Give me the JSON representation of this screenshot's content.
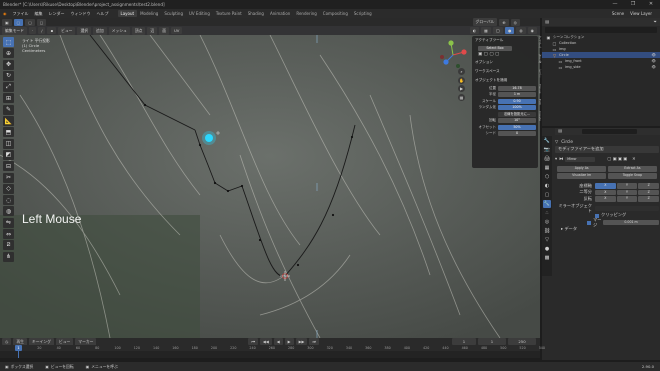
{
  "window": {
    "title": "Blender* [C:\\Users\\Rikuse\\Desktop\\Blender\\project_assignments\\test2.blend]",
    "controls": [
      "—",
      "❐",
      "✕"
    ]
  },
  "menu": {
    "app_icon": "blender-logo-icon",
    "items": [
      "ファイル",
      "編集",
      "レンダー",
      "ウィンドウ",
      "ヘルプ"
    ],
    "workspaces": [
      "Layout",
      "Modeling",
      "Sculpting",
      "UV Editing",
      "Texture Paint",
      "Shading",
      "Animation",
      "Rendering",
      "Compositing",
      "Scripting"
    ],
    "active_workspace": "Layout",
    "scene": "Scene",
    "view_layer": "View Layer"
  },
  "viewport_header": {
    "mode": "編集モード",
    "items": [
      "ビュー",
      "選択",
      "追加",
      "メッシュ",
      "頂点",
      "辺",
      "面",
      "UV"
    ],
    "transform": "グローバル"
  },
  "viewport_info": {
    "line1": "ライト 平行投影",
    "line2": "(1) Circle",
    "line3": "Centimeters"
  },
  "keycast": "Left Mouse",
  "npanel": {
    "sections": [
      "アクティブツール",
      "オプション",
      "ワークスペース",
      "オブジェクトを適用"
    ],
    "select_box": "Select Box",
    "fields": [
      {
        "label": "位置",
        "value": "16.78"
      },
      {
        "label": "半径",
        "value": "1 m"
      },
      {
        "label": "スケール",
        "value": "0.90"
      },
      {
        "label": "ランダム化",
        "value": "100%"
      },
      {
        "label": "",
        "value": "法線を投影元に..."
      },
      {
        "label": "回転",
        "value": "10°"
      },
      {
        "label": "オフセット",
        "value": "50%"
      },
      {
        "label": "シード",
        "value": "0"
      }
    ],
    "tabs": [
      "アイテム",
      "ツール",
      "ビュー",
      "Tissue",
      "Edit",
      "Create"
    ]
  },
  "outliner": {
    "header": "シーンコレクション",
    "rows": [
      {
        "name": "Collection",
        "icon": "collection-icon",
        "selected": false
      },
      {
        "name": "img",
        "icon": "image-icon",
        "selected": false
      },
      {
        "name": "Circle",
        "icon": "mesh-icon",
        "selected": true
      },
      {
        "name": "img_front",
        "icon": "image-icon",
        "selected": false
      },
      {
        "name": "img_side",
        "icon": "image-icon",
        "selected": false
      }
    ]
  },
  "properties": {
    "object": "Circle",
    "panel": "モディファイアーを追加",
    "modifier": "Mirror",
    "buttons": [
      "Apply As",
      "Extract As",
      "Visualize Im",
      "Toggle Snap"
    ],
    "axis_labels": [
      "座標軸",
      "二等分",
      "反転"
    ],
    "axes": [
      "X",
      "Y",
      "Z"
    ],
    "mirror_object": "ミラーオブジェクト",
    "clipping": "クリッピング",
    "merge": "マージ",
    "merge_value": "0.001 m",
    "data": "データ"
  },
  "timeline": {
    "menu": [
      "再生",
      "キーイング",
      "ビュー",
      "マーカー"
    ],
    "frame": "1",
    "start": "1",
    "end": "250",
    "ticks": [
      "0",
      "20",
      "40",
      "60",
      "80",
      "100",
      "120",
      "140",
      "160",
      "180",
      "200",
      "220",
      "240",
      "260",
      "280",
      "300",
      "320",
      "340",
      "360",
      "380",
      "400",
      "420",
      "440",
      "460",
      "480",
      "500",
      "520",
      "540"
    ]
  },
  "statusbar": {
    "items": [
      "ボックス選択",
      "ビューを回転",
      "メニューを呼ぶ"
    ],
    "version": "2.90.0"
  }
}
